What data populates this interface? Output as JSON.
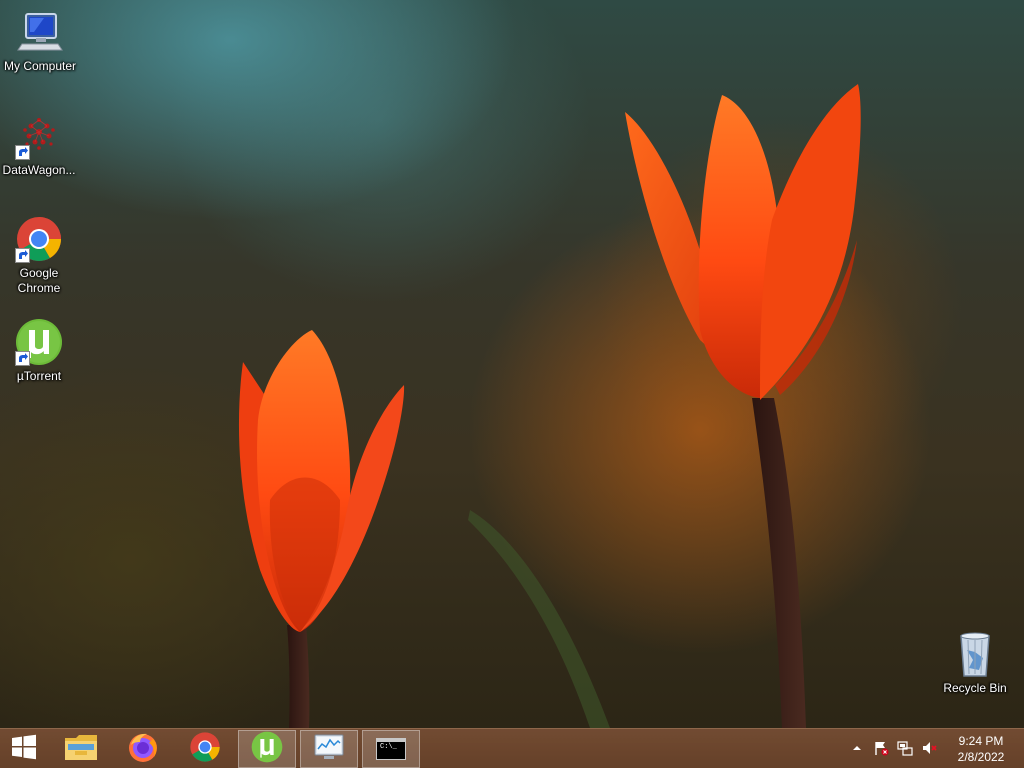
{
  "desktop": {
    "icons": [
      {
        "id": "my-computer",
        "label": "My Computer"
      },
      {
        "id": "datawagon",
        "label": "DataWagon..."
      },
      {
        "id": "google-chrome",
        "label": "Google Chrome"
      },
      {
        "id": "utorrent",
        "label": "µTorrent"
      },
      {
        "id": "recycle-bin",
        "label": "Recycle Bin"
      }
    ]
  },
  "taskbar": {
    "pinned": [
      {
        "name": "start-button",
        "icon": "windows-logo-icon"
      },
      {
        "name": "file-explorer",
        "icon": "folder-icon"
      },
      {
        "name": "firefox",
        "icon": "firefox-icon"
      },
      {
        "name": "chrome",
        "icon": "chrome-icon"
      },
      {
        "name": "utorrent",
        "icon": "utorrent-icon",
        "active": true
      },
      {
        "name": "resource-monitor",
        "icon": "monitor-chart-icon"
      },
      {
        "name": "command-prompt",
        "icon": "terminal-icon"
      }
    ],
    "cmd_prompt_text": "C:\\_"
  },
  "tray": {
    "icons": [
      "show-hidden-icons-chevron",
      "action-center-flag-icon",
      "network-icon",
      "volume-muted-icon"
    ],
    "time": "9:24 PM",
    "date": "2/8/2022"
  },
  "colors": {
    "taskbar": "#6e4a30",
    "tulip": "#ff4a12",
    "chrome_red": "#db4437",
    "chrome_green": "#0f9d58",
    "chrome_yellow": "#f4b400",
    "chrome_blue": "#4285f4",
    "utorrent_green": "#6dbb39"
  }
}
